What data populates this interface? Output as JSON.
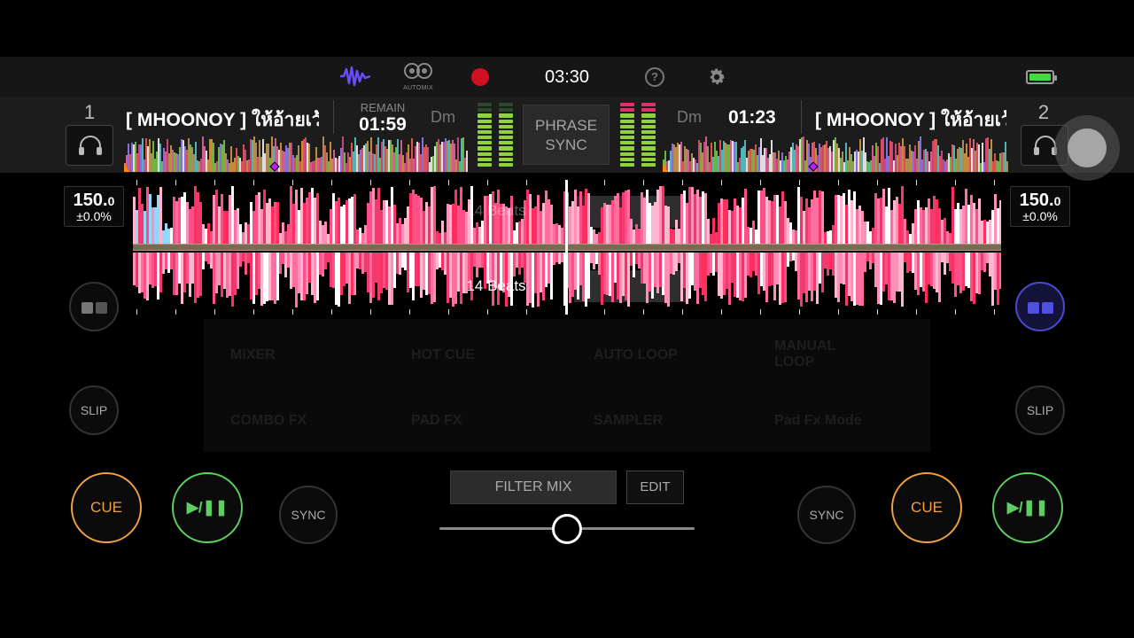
{
  "header": {
    "clock": "03:30",
    "automix_label": "AUTOMIX",
    "icons": [
      "waveform-icon",
      "automix-icon",
      "record-icon",
      "help-icon",
      "settings-icon",
      "battery-icon"
    ],
    "help_glyph": "?"
  },
  "center": {
    "phrase_sync_line1": "PHRASE",
    "phrase_sync_line2": "SYNC",
    "filter_mix": "FILTER MIX",
    "edit": "EDIT",
    "crossfader_position": 0.5
  },
  "deck1": {
    "number": "1",
    "title": "[ MHOONOY ] ให้อ้ายเว้าแหน่",
    "remain_label": "REMAIN",
    "remain_time": "01:59",
    "key": "Dm",
    "bpm_int": "150.",
    "bpm_dec": "0",
    "pitch": "±0.0%",
    "beats_label": "14 Beats",
    "slip": "SLIP",
    "sync": "SYNC",
    "cue": "CUE",
    "play": "▶/❚❚"
  },
  "deck2": {
    "number": "2",
    "title": "[ MHOONOY ] ให้อ้ายเว้าแหน่",
    "elapsed_time": "01:23",
    "key": "Dm",
    "bpm_int": "150.",
    "bpm_dec": "0",
    "pitch": "±0.0%",
    "beats_label": "14 Beats",
    "slip": "SLIP",
    "sync": "SYNC",
    "cue": "CUE",
    "play": "▶/❚❚"
  },
  "hidden_menu": [
    "MIXER",
    "HOT CUE",
    "AUTO LOOP",
    "MANUAL LOOP",
    "COMBO FX",
    "PAD FX",
    "SAMPLER",
    "Pad Fx Mode"
  ],
  "colors": {
    "cue": "#f0a040",
    "play": "#5cd060",
    "record": "#d01020",
    "automix_wave": "#6c4cff",
    "battery": "#3be03b",
    "pad_mode_active": "#5050e0"
  }
}
